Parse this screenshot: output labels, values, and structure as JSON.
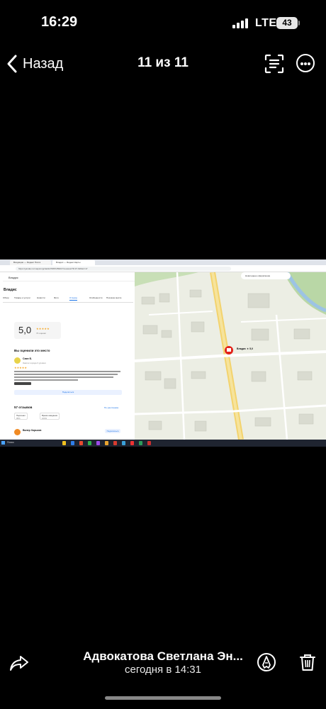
{
  "status_bar": {
    "time": "16:29",
    "network": "LTE",
    "battery": "43"
  },
  "nav": {
    "back_label": "Назад",
    "counter": "11 из 11"
  },
  "photo": {
    "browser_tabs": [
      "Входящие — Яндекс Почта",
      "Владис — Яндекс Карты"
    ],
    "url": "https://yandex.ru/maps/org/vladis/76867259617/reviews/?ll=37.626&z=17",
    "left_panel": {
      "search": "Владис",
      "title": "Владис",
      "tabs": [
        "Обзор",
        "Товары и услуги",
        "Новости",
        "Фото",
        "Отзывы",
        "Особенности",
        "Похожие места"
      ],
      "rating": "5,0",
      "rating_count": "74 оценки",
      "rate_title": "Вы оценили это место",
      "review_author": "Саян Б.",
      "review_sub": "Знаток города 3 уровня",
      "reply_button": "Поделиться",
      "reviews_count": "57 отзывов",
      "sort_label": "По умолчанию",
      "chips": [
        {
          "label": "Персонал",
          "value": "95%"
        },
        {
          "label": "Время ожидания",
          "value": "100%"
        }
      ],
      "second_author": "Валер Хорьков",
      "subscribe": "Подписаться"
    },
    "map": {
      "place_label": "Владис",
      "place_rating": "5,0",
      "search_pill": "Новогоднее оформление"
    },
    "taskbar_search": "Поиск"
  },
  "caption": {
    "name": "Адвокатова Светлана Эн...",
    "time": "сегодня в 14:31"
  },
  "icons": [
    "back-chevron-icon",
    "live-text-icon",
    "more-icon",
    "share-icon",
    "markup-icon",
    "trash-icon"
  ]
}
